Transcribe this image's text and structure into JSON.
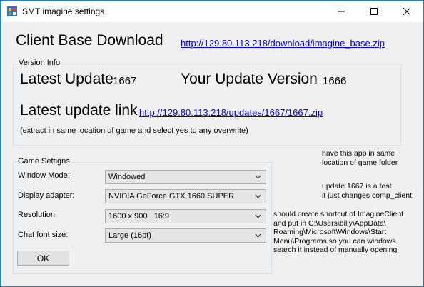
{
  "window": {
    "title": "SMT imagine settings"
  },
  "client_base": {
    "heading": "Client Base Download",
    "link": "http://129.80.113.218/download/imagine_base.zip"
  },
  "version_info": {
    "legend": "Version Info",
    "latest_update_label": "Latest Update",
    "latest_update_value": "1667",
    "your_update_label": "Your Update Version",
    "your_update_value": "1666",
    "latest_link_label": "Latest update link",
    "latest_link": "http://129.80.113.218/updates/1667/1667.zip",
    "note": "(extract in same location of game and select yes to any overwrite)"
  },
  "game_settings": {
    "legend": "Game Settigns",
    "rows": [
      {
        "label": "Window Mode:",
        "value": "Windowed"
      },
      {
        "label": "Display adapter:",
        "value": "NVIDIA GeForce GTX 1660 SUPER"
      },
      {
        "label": "Resolution:",
        "value": "1600 x 900   16:9"
      },
      {
        "label": "Chat font size:",
        "value": "Large (16pt)"
      }
    ],
    "ok_label": "OK"
  },
  "notes": {
    "note1": "have this app in same\nlocation of game folder",
    "note2": "update 1667 is a test\nit just changes comp_client",
    "note3": "should create shortcut of ImagineClient\nand put in C:\\Users\\billy\\AppData\\\nRoaming\\Microsoft\\Windows\\Start\nMenu\\Programs so you can windows\nsearch it instead of manually opening"
  },
  "colors": {
    "link": "#0000ee",
    "window_border": "#1883d7",
    "background": "#f0f0f0"
  }
}
